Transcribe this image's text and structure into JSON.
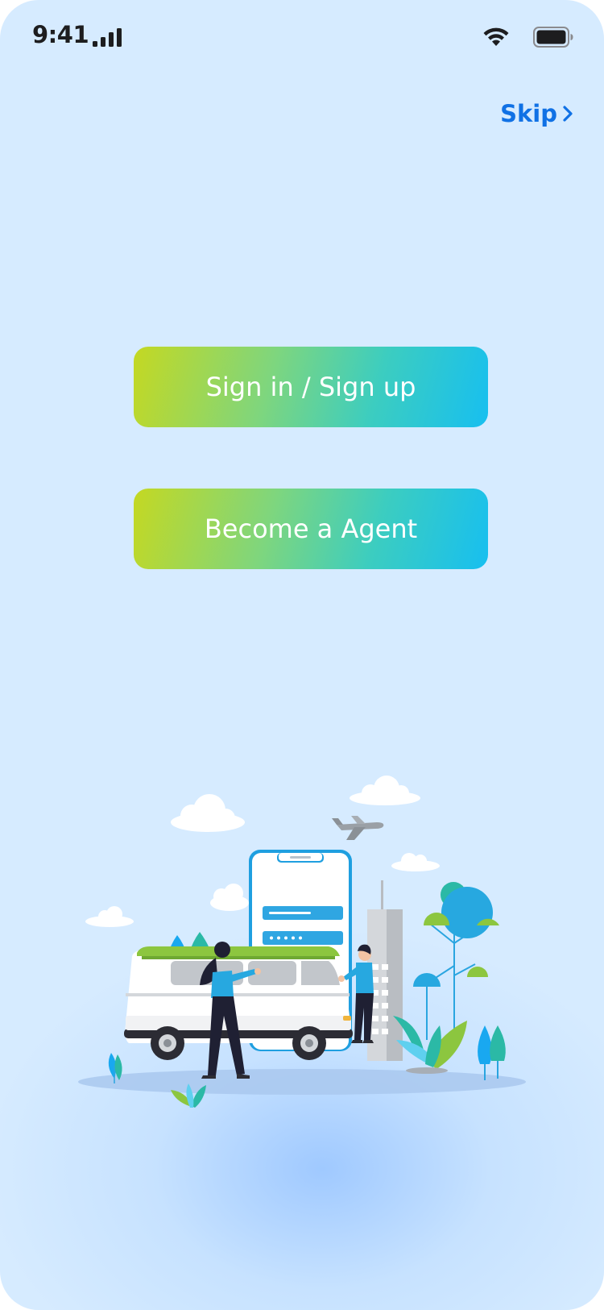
{
  "status_bar": {
    "time": "9:41",
    "icons": [
      "signal-icon",
      "wifi-icon",
      "battery-icon"
    ]
  },
  "header": {
    "skip_label": "Skip",
    "skip_icon": "chevron-right-icon"
  },
  "actions": {
    "signin_label": "Sign in / Sign up",
    "agent_label": "Become a Agent"
  },
  "colors": {
    "background": "#d6ebff",
    "accent_link": "#1071e5",
    "button_gradient_start": "#c4d822",
    "button_gradient_end": "#17bff0",
    "button_text": "#ffffff"
  }
}
